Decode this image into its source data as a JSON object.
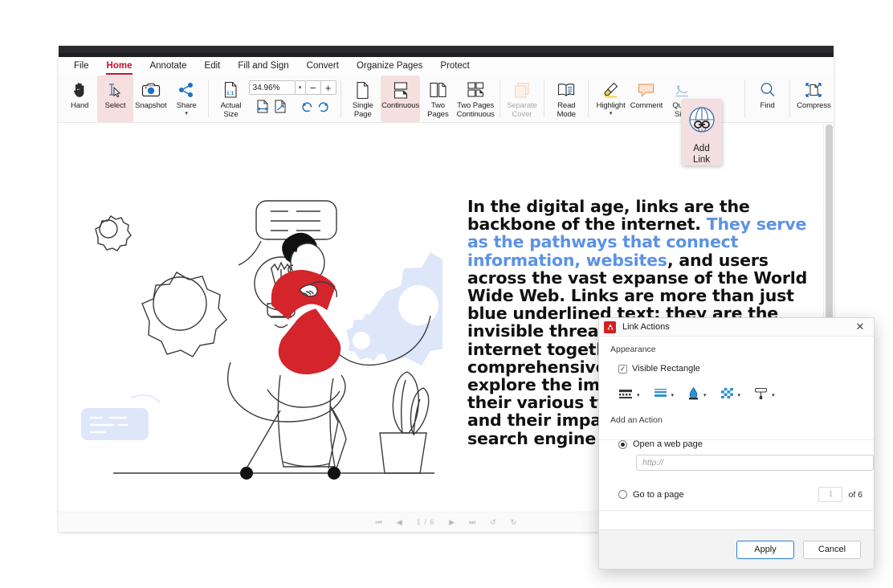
{
  "app": {
    "menu": [
      {
        "label": "File",
        "active": false
      },
      {
        "label": "Home",
        "active": true
      },
      {
        "label": "Annotate",
        "active": false
      },
      {
        "label": "Edit",
        "active": false
      },
      {
        "label": "Fill and Sign",
        "active": false
      },
      {
        "label": "Convert",
        "active": false
      },
      {
        "label": "Organize Pages",
        "active": false
      },
      {
        "label": "Protect",
        "active": false
      }
    ],
    "accent_color": "#c8102e",
    "selected_tool_bg": "#f6dfdf"
  },
  "ribbon": {
    "hand": "Hand",
    "select": "Select",
    "snapshot": "Snapshot",
    "share": "Share",
    "actual_size_l1": "Actual",
    "actual_size_l2": "Size",
    "zoom_value": "34.96%",
    "zoom_out": "−",
    "zoom_in": "+",
    "single_page_l1": "Single",
    "single_page_l2": "Page",
    "continuous": "Continuous",
    "two_pages_l1": "Two",
    "two_pages_l2": "Pages",
    "two_pages_cont_l1": "Two Pages",
    "two_pages_cont_l2": "Continuous",
    "separate_cover_l1": "Separate",
    "separate_cover_l2": "Cover",
    "read_mode_l1": "Read",
    "read_mode_l2": "Mode",
    "highlight": "Highlight",
    "comment": "Comment",
    "quick_sign_l1": "Quick",
    "quick_sign_l2": "Sign",
    "find": "Find",
    "compress": "Compress",
    "add_link_l1": "Add",
    "add_link_l2": "Link"
  },
  "document": {
    "paragraph_parts": [
      {
        "text": "In the digital age, links are the backbone of the internet. ",
        "link": false
      },
      {
        "text": "They serve as the pathways that connect information, websites",
        "link": true
      },
      {
        "text": ", and users across the vast expanse of the World Wide Web. Links are more than just blue underlined text; they are the invisible threads that weave the internet together. In this comprehensive guide, we will explore the importance of links, their various types, how they work, and their impact on everything from search engine optimization (SEO) t",
        "link": false
      }
    ],
    "link_color": "#5b92e5"
  },
  "statusbar": {
    "first_page_icon": "⏮",
    "prev_page_icon": "◀",
    "page_indicator": "1 / 6",
    "next_page_icon": "▶",
    "last_page_icon": "⏭",
    "rotate_ccw_icon": "↺",
    "rotate_cw_icon": "↻"
  },
  "dialog": {
    "title": "Link Actions",
    "close_icon": "✕",
    "appearance_label": "Appearance",
    "visible_rectangle_label": "Visible Rectangle",
    "visible_rectangle_checked": true,
    "check_glyph": "✓",
    "appearance_icons": [
      {
        "name": "border-style-dropdown",
        "caret": "▾"
      },
      {
        "name": "line-thickness-dropdown",
        "caret": "▾"
      },
      {
        "name": "line-color-dropdown",
        "caret": "▾"
      },
      {
        "name": "fill-color-dropdown",
        "caret": "▾"
      },
      {
        "name": "highlight-style-dropdown",
        "caret": "▾"
      }
    ],
    "add_action_label": "Add an Action",
    "open_web_page_label": "Open a web page",
    "open_web_page_selected": true,
    "url_placeholder": "http://",
    "url_value": "",
    "go_to_page_label": "Go to a page",
    "go_to_page_selected": false,
    "page_number_value": "1",
    "page_total_label": "of 6",
    "apply_label": "Apply",
    "cancel_label": "Cancel",
    "primary_border_color": "#2a7fd4"
  }
}
